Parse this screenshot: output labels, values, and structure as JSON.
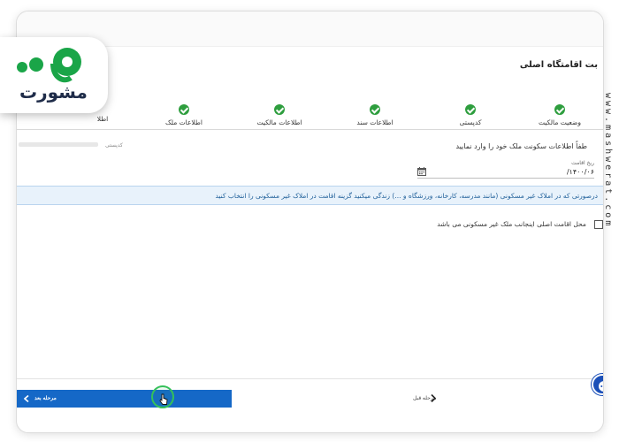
{
  "page": {
    "title": "بت اقامتگاه اصلی"
  },
  "steps": [
    {
      "label": "وضعیت مالکیت"
    },
    {
      "label": "کدپستی"
    },
    {
      "label": "اطلاعات سند"
    },
    {
      "label": "اطلاعات مالکیت"
    },
    {
      "label": "اطلاعات ملک"
    },
    {
      "label": "اطلا"
    }
  ],
  "form": {
    "instruction": "طفاً اطلاعات سکونت ملک خود را وارد نمایید",
    "postal_label": "کدپستی",
    "date_label": "ریخ اقامت",
    "date_value": "۱۴۰۰/۰۶/"
  },
  "info": {
    "text": "درصورتی که در املاک غیر مسکونی (مانند مدرسه، کارخانه، ورزشگاه و ...) زندگی میکنید گزینه اقامت در املاک غیر مسکونی را انتخاب کنید"
  },
  "checkbox": {
    "label": "محل اقامت اصلی اینجانب ملک غیر مسکونی می باشد"
  },
  "buttons": {
    "next_label": "مرحله بعد",
    "prev_label": "مرحله قبل"
  },
  "logo": {
    "text": "مشورت"
  },
  "watermark": {
    "text": "www.mashwerat.com"
  },
  "colors": {
    "primary": "#1568c7",
    "success": "#2e9e3e",
    "info_bg": "#e8f2fb",
    "info_text": "#1f5f99",
    "logo_green": "#1aa548",
    "logo_navy": "#1f2c49"
  }
}
